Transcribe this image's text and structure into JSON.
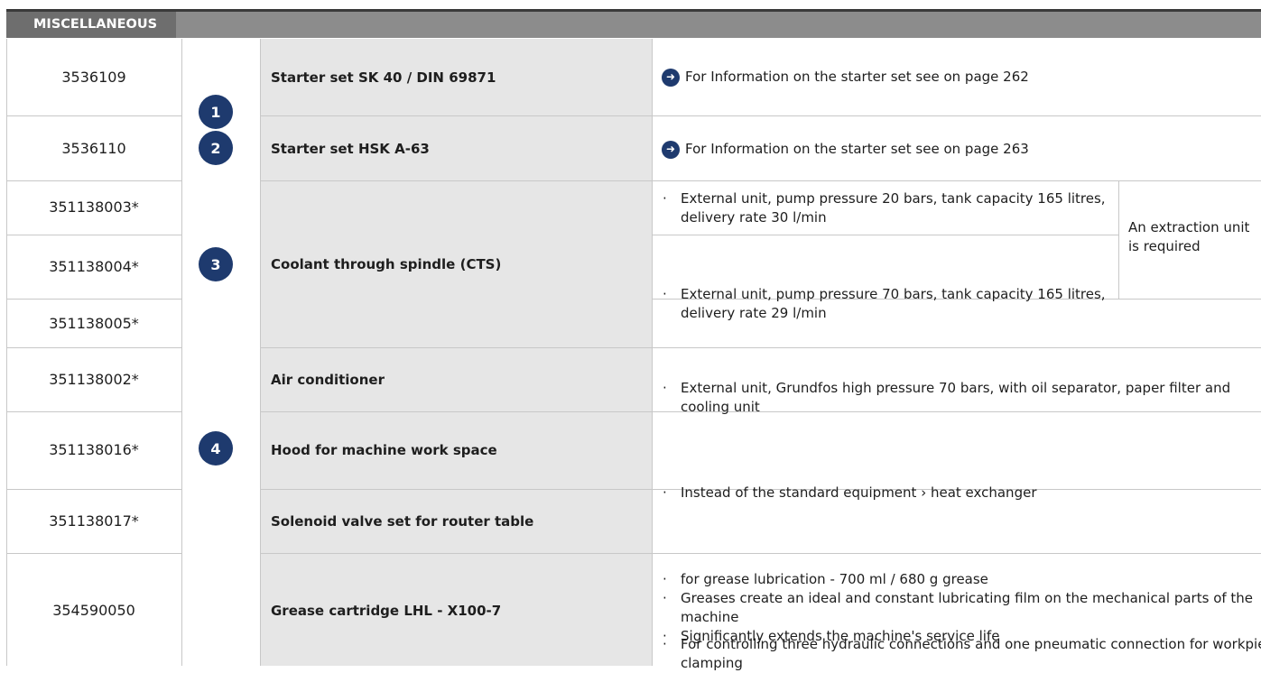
{
  "header": {
    "title": "MISCELLANEOUS"
  },
  "badges": [
    "1",
    "2",
    "3",
    "4"
  ],
  "items": [
    {
      "number": "3536109",
      "name": "Starter set SK 40 / DIN 69871",
      "info": "For Information on the starter set see on page 262"
    },
    {
      "number": "3536110",
      "name": "Starter set HSK A-63",
      "info": "For Information on the starter set see on page 263"
    },
    {
      "number": "351138003*",
      "desc": "External unit, pump pressure 20 bars, tank capacity 165 litres, delivery rate 30 l/min"
    },
    {
      "number": "351138004*",
      "desc": "External unit, pump pressure 70 bars, tank capacity 165 litres, delivery rate 29 l/min"
    },
    {
      "number": "351138005*",
      "desc": "External unit, Grundfos high pressure 70 bars, with oil separator, paper filter and cooling unit"
    },
    {
      "number": "351138002*",
      "name": "Air conditioner",
      "desc": "Instead of the standard equipment › heat exchanger"
    },
    {
      "number": "351138016*",
      "name": "Hood for machine work space"
    },
    {
      "number": "351138017*",
      "name": "Solenoid valve set for router table",
      "desc": "For controlling three hydraulic connections and one pneumatic connection for workpiece clamping"
    },
    {
      "number": "354590050",
      "name": "Grease cartridge LHL - X100-7",
      "bullets": [
        "for grease lubrication - 700 ml / 680 g grease",
        "Greases create an ideal and constant lubricating film on the mechanical parts of the machine",
        "Significantly extends the machine's service life"
      ]
    }
  ],
  "coolant_group": {
    "name": "Coolant through spindle (CTS)",
    "note": "An extraction unit is required"
  },
  "bullet_char": "·",
  "icons": {
    "arrow": "arrow-right-circle-icon"
  },
  "colors": {
    "badge": "#1e3a6e",
    "header_tab": "#6e6e6e",
    "header_bar": "#8c8c8c",
    "name_cell_bg": "#e6e6e6"
  }
}
